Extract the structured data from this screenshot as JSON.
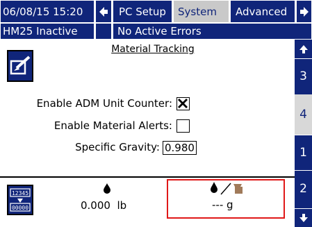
{
  "header": {
    "datetime": "06/08/15 15:20",
    "tabs": [
      {
        "label": "PC Setup",
        "active": false
      },
      {
        "label": "System",
        "active": true
      },
      {
        "label": "Advanced",
        "active": false
      }
    ],
    "status_left": "HM25 Inactive",
    "status_right": "No Active Errors"
  },
  "sidebar": {
    "items": [
      {
        "label": "3",
        "active": false
      },
      {
        "label": "4",
        "active": true
      },
      {
        "label": "1",
        "active": false
      },
      {
        "label": "2",
        "active": false
      }
    ]
  },
  "main": {
    "title": "Material Tracking",
    "fields": {
      "adm_counter": {
        "label": "Enable ADM Unit Counter:",
        "checked": true
      },
      "material_alerts": {
        "label": "Enable Material Alerts:",
        "checked": false
      },
      "specific_gravity": {
        "label": "Specific Gravity:",
        "value": "0.980"
      }
    }
  },
  "footer": {
    "counter_icon_top": "12345",
    "counter_icon_bottom": "00000",
    "total_value": "0.000",
    "total_unit": "lb",
    "ratio_value": "--- g"
  },
  "colors": {
    "accent": "#10257a",
    "highlight": "#e01818",
    "tab_active": "#c9c9c9"
  },
  "icons": [
    "left-arrow-icon",
    "right-arrow-icon",
    "up-arrow-icon",
    "down-arrow-icon",
    "edit-icon",
    "counter-icon",
    "drop-icon",
    "drop-ratio-icon"
  ]
}
